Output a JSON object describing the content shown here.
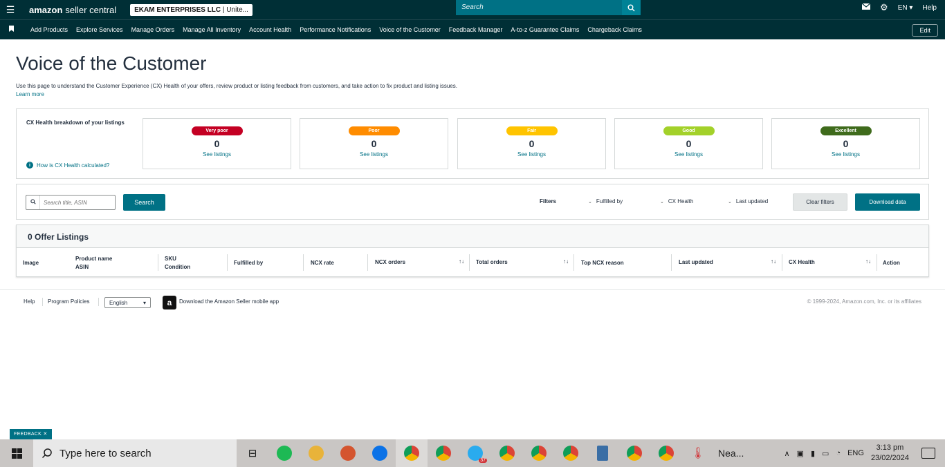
{
  "header": {
    "logo_brand": "amazon",
    "logo_product": "seller central",
    "account_name": "EKAM ENTERPRISES LLC",
    "account_region": "| Unite...",
    "search_placeholder": "Search",
    "language": "EN",
    "help": "Help"
  },
  "nav": {
    "items": [
      "Add Products",
      "Explore Services",
      "Manage Orders",
      "Manage All Inventory",
      "Account Health",
      "Performance Notifications",
      "Voice of the Customer",
      "Feedback Manager",
      "A-to-z Guarantee Claims",
      "Chargeback Claims"
    ],
    "edit": "Edit"
  },
  "page": {
    "title": "Voice of the Customer",
    "intro": "Use this page to understand the Customer Experience (CX) Health of your offers, review product or listing feedback from customers, and take action to fix product and listing issues.",
    "learn_more": "Learn more"
  },
  "health": {
    "title": "CX Health breakdown of your listings",
    "how_calc": "How is CX Health calculated?",
    "cards": [
      {
        "label": "Very poor",
        "count": "0",
        "link": "See listings",
        "color": "#c40023",
        "text_color": "#ffffff"
      },
      {
        "label": "Poor",
        "count": "0",
        "link": "See listings",
        "color": "#ff8c00",
        "text_color": "#ffffff"
      },
      {
        "label": "Fair",
        "count": "0",
        "link": "See listings",
        "color": "#ffc400",
        "text_color": "#ffffff"
      },
      {
        "label": "Good",
        "count": "0",
        "link": "See listings",
        "color": "#a3d12a",
        "text_color": "#ffffff"
      },
      {
        "label": "Excellent",
        "count": "0",
        "link": "See listings",
        "color": "#3f6b1c",
        "text_color": "#ffffff"
      }
    ]
  },
  "filters": {
    "search_placeholder": "Search title, ASIN",
    "search_button": "Search",
    "label": "Filters",
    "fulfilled_by": "Fulfilled by",
    "cx_health": "CX Health",
    "last_updated": "Last updated",
    "clear": "Clear filters",
    "download": "Download data"
  },
  "table": {
    "title": "0 Offer Listings",
    "columns": {
      "image": "Image",
      "product_name": "Product name",
      "asin": "ASIN",
      "sku": "SKU",
      "condition": "Condition",
      "fulfilled_by": "Fulfilled by",
      "ncx_rate": "NCX rate",
      "ncx_orders": "NCX orders",
      "total_orders": "Total orders",
      "top_ncx_reason": "Top NCX reason",
      "last_updated": "Last updated",
      "cx_health": "CX Health",
      "action": "Action"
    }
  },
  "footer": {
    "help": "Help",
    "program_policies": "Program Policies",
    "language": "English",
    "app": "Download the Amazon Seller mobile app",
    "copyright": "© 1999-2024, Amazon.com, Inc. or its affiliates"
  },
  "feedback_tab": "FEEDBACK",
  "taskbar": {
    "search": "Type here to search",
    "weather": "Nea...",
    "badge_telegram": "37",
    "language": "ENG",
    "time": "3:13 pm",
    "date": "23/02/2024"
  },
  "colors": {
    "header_bg": "#002f36",
    "accent": "#007185"
  }
}
